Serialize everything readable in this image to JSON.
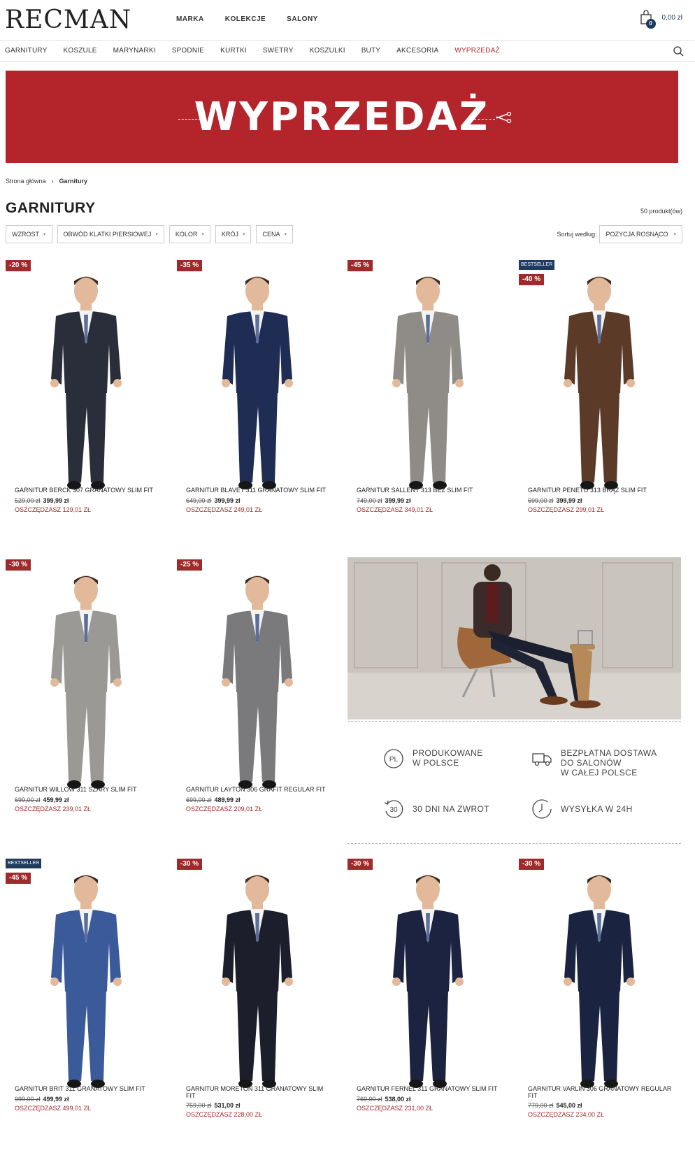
{
  "header": {
    "logo": "RECMAN",
    "topnav": [
      "MARKA",
      "KOLEKCJE",
      "SALONY"
    ],
    "cart_count": "0",
    "cart_total": "0,00 zł"
  },
  "catnav": [
    "GARNITURY",
    "KOSZULE",
    "MARYNARKI",
    "SPODNIE",
    "KURTKI",
    "SWETRY",
    "KOSZULKI",
    "BUTY",
    "AKCESORIA",
    "WYPRZEDAŻ"
  ],
  "banner": {
    "text": "WYPRZEDAŻ"
  },
  "breadcrumb": {
    "home": "Strona główna",
    "current": "Garnitury"
  },
  "page": {
    "title": "GARNITURY",
    "count": "50 produkt(ów)"
  },
  "filters": [
    "WZROST",
    "OBWÓD KLATKI PIERSIOWEJ",
    "KOLOR",
    "KRÓJ",
    "CENA"
  ],
  "sort": {
    "label": "Sortuj według:",
    "value": "POZYCJA ROSNĄCO"
  },
  "products": [
    {
      "discount": "-20 %",
      "bestseller": "",
      "name": "GARNITUR BERCK 307 GRANATOWY SLIM FIT",
      "old": "529,00 zł",
      "new": "399,99 zł",
      "save": "OSZCZĘDZASZ 129,01 ZŁ",
      "color": "#2a2d3a"
    },
    {
      "discount": "-35 %",
      "bestseller": "",
      "name": "GARNITUR BLAVET 311 GRANATOWY SLIM FIT",
      "old": "649,00 zł",
      "new": "399,99 zł",
      "save": "OSZCZĘDZASZ 249,01 ZŁ",
      "color": "#1f2d55"
    },
    {
      "discount": "-45 %",
      "bestseller": "",
      "name": "GARNITUR SALLENT 313 BEŻ SLIM FIT",
      "old": "749,00 zł",
      "new": "399,99 zł",
      "save": "OSZCZĘDZASZ 349,01 ZŁ",
      "color": "#8f8b86"
    },
    {
      "discount": "-40 %",
      "bestseller": "BESTSELLER",
      "name": "GARNITUR PENETO 313 BRĄZ SLIM FIT",
      "old": "699,00 zł",
      "new": "399,99 zł",
      "save": "OSZCZĘDZASZ 299,01 ZŁ",
      "color": "#5b3a28"
    },
    {
      "discount": "-30 %",
      "bestseller": "",
      "name": "GARNITUR WILLOW 311 SZARY SLIM FIT",
      "old": "699,00 zł",
      "new": "459,99 zł",
      "save": "OSZCZĘDZASZ 239,01 ZŁ",
      "color": "#9a9995"
    },
    {
      "discount": "-25 %",
      "bestseller": "",
      "name": "GARNITUR LAYTON 306 GRAFIT REGULAR FIT",
      "old": "699,00 zł",
      "new": "489,99 zł",
      "save": "OSZCZĘDZASZ 209,01 ZŁ",
      "color": "#7a7a7c"
    },
    {
      "discount": "-45 %",
      "bestseller": "BESTSELLER",
      "name": "GARNITUR BRIT 311 GRANATOWY SLIM FIT",
      "old": "999,00 zł",
      "new": "499,99 zł",
      "save": "OSZCZĘDZASZ 499,01 ZŁ",
      "color": "#3a5a9a"
    },
    {
      "discount": "-30 %",
      "bestseller": "",
      "name": "GARNITUR MORETON 311 GRANATOWY SLIM FIT",
      "old": "759,00 zł",
      "new": "531,00 zł",
      "save": "OSZCZĘDZASZ 228,00 ZŁ",
      "color": "#1c1f2b"
    },
    {
      "discount": "-30 %",
      "bestseller": "",
      "name": "GARNITUR FERNEL 311 GRANATOWY SLIM FIT",
      "old": "769,00 zł",
      "new": "538,00 zł",
      "save": "OSZCZĘDZASZ 231,00 ZŁ",
      "color": "#1b2340"
    },
    {
      "discount": "-30 %",
      "bestseller": "",
      "name": "GARNITUR VARLIN 306 GRANATOWY REGULAR FIT",
      "old": "779,00 zł",
      "new": "545,00 zł",
      "save": "OSZCZĘDZASZ 234,00 ZŁ",
      "color": "#1a2440"
    }
  ],
  "features": [
    {
      "icon": "pl-badge-icon",
      "text": "PRODUKOWANE\nW POLSCE"
    },
    {
      "icon": "delivery-truck-icon",
      "text": "BEZPŁATNA DOSTAWA\nDO SALONÓW\nW CAŁEJ POLSCE"
    },
    {
      "icon": "30-days-return-icon",
      "text": "30 DNI NA ZWROT"
    },
    {
      "icon": "clock-24h-icon",
      "text": "WYSYŁKA W 24H"
    }
  ],
  "features_return_badge": "30",
  "features_pl_badge": "PL"
}
